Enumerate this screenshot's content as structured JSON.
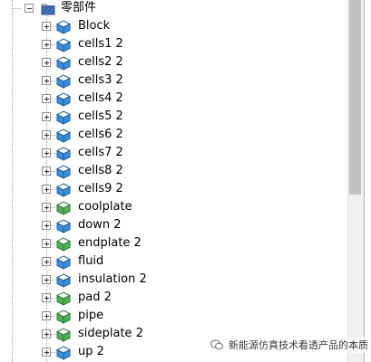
{
  "tree": {
    "root": {
      "label": "零部件"
    },
    "items": [
      {
        "label": "Block",
        "icon": "blue-part-icon"
      },
      {
        "label": "cells1 2",
        "icon": "blue-part-icon"
      },
      {
        "label": "cells2 2",
        "icon": "blue-part-icon"
      },
      {
        "label": "cells3 2",
        "icon": "blue-part-icon"
      },
      {
        "label": "cells4 2",
        "icon": "blue-part-icon"
      },
      {
        "label": "cells5 2",
        "icon": "blue-part-icon"
      },
      {
        "label": "cells6 2",
        "icon": "blue-part-icon"
      },
      {
        "label": "cells7 2",
        "icon": "blue-part-icon"
      },
      {
        "label": "cells8 2",
        "icon": "blue-part-icon"
      },
      {
        "label": "cells9 2",
        "icon": "blue-part-icon"
      },
      {
        "label": "coolplate",
        "icon": "green-part-icon"
      },
      {
        "label": "down 2",
        "icon": "blue-part-icon"
      },
      {
        "label": "endplate 2",
        "icon": "green-part-icon"
      },
      {
        "label": "fluid",
        "icon": "blue-part-icon"
      },
      {
        "label": "insulation 2",
        "icon": "blue-part-icon"
      },
      {
        "label": "pad 2",
        "icon": "green-part-icon"
      },
      {
        "label": "pipe",
        "icon": "green-part-icon"
      },
      {
        "label": "sideplate 2",
        "icon": "green-part-icon"
      },
      {
        "label": "up 2",
        "icon": "blue-part-icon"
      }
    ]
  },
  "watermark": {
    "text": "新能源仿真技术看透产品的本质"
  },
  "colors": {
    "blue_part": "#3a8fd8",
    "green_part": "#4fae56"
  }
}
